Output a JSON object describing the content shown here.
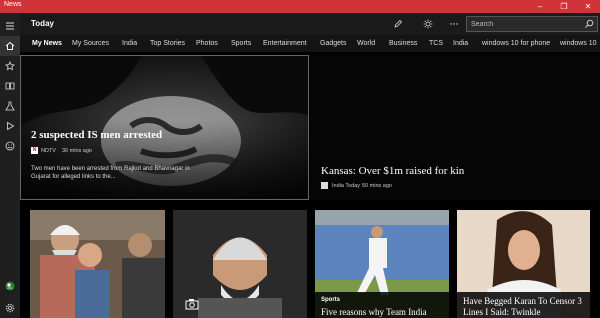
{
  "window": {
    "title": "News",
    "controls": [
      "–",
      "❐",
      "✕"
    ]
  },
  "header": {
    "title": "Today",
    "search_placeholder": "Search"
  },
  "tabs": [
    "My News",
    "My Sources",
    "India",
    "Top Stories",
    "Photos",
    "Sports",
    "Entertainment",
    "Gadgets",
    "World",
    "Business",
    "TCS",
    "India",
    "windows 10 for phone",
    "windows 10"
  ],
  "sidebar": {
    "items": [
      "menu-icon",
      "home-icon",
      "star-icon",
      "book-icon",
      "flask-icon",
      "play-icon",
      "smile-icon"
    ],
    "bottom": [
      "avatar",
      "gear-icon"
    ]
  },
  "hero": {
    "title": "2 suspected IS men arrested",
    "source_logo": "N",
    "source": "NDTV",
    "time": "30 mins ago",
    "summary": "Two men have been arrested from Rajkot and Bhavnagar in Gujarat for alleged links to the..."
  },
  "side_story": {
    "title": "Kansas: Over $1m raised for kin",
    "source": "India Today",
    "time": "50 mins ago"
  },
  "cards": [
    {
      "category": "",
      "title": ""
    },
    {
      "category": "",
      "title": ""
    },
    {
      "category": "Sports",
      "title": "Five reasons why Team India"
    },
    {
      "category": "",
      "title": "Have Begged Karan To Censor 3 Lines I Said: Twinkle"
    }
  ],
  "colors": {
    "accent": "#d13438",
    "ndtv": "#cc2222"
  }
}
